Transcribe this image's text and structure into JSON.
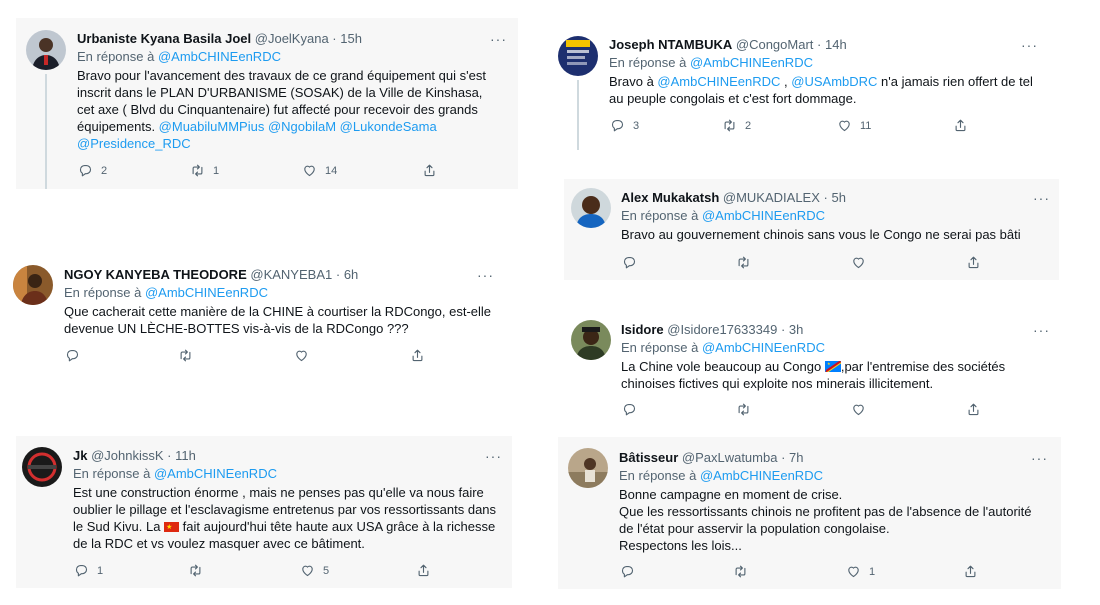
{
  "reply_prefix": "En réponse à",
  "reply_to": "@AmbCHINEenRDC",
  "more": "···",
  "sep": "·",
  "colors": {
    "link": "#1d9bf0",
    "muted": "#536471",
    "card_bg": "#f7f7f7"
  },
  "tweets": [
    {
      "name": "Urbaniste Kyana Basila Joel",
      "handle": "@JoelKyana",
      "time": "15h",
      "text_1": "Bravo pour l'avancement des travaux de ce grand équipement qui s'est inscrit dans le PLAN D'URBANISME (SOSAK) de la Ville de Kinshasa, cet axe ( Blvd du Cinquantenaire) fut affecté pour recevoir des grands équipements. ",
      "mentions": "@MuabiluMMPius @NgobilaM @LukondeSama @Presidence_RDC",
      "replies": "2",
      "retweets": "1",
      "likes": "14"
    },
    {
      "name": "NGOY KANYEBA THEODORE",
      "handle": "@KANYEBA1",
      "time": "6h",
      "text": "Que cacherait cette manière de la CHINE à courtiser la RDCongo, est-elle devenue UN LÈCHE-BOTTES vis-à-vis de la RDCongo ???",
      "replies": "",
      "retweets": "",
      "likes": ""
    },
    {
      "name": "Jk",
      "handle": "@JohnkissK",
      "time": "11h",
      "text_1": "Est une construction énorme , mais ne penses pas qu'elle va nous faire oublier le pillage et l'esclavagisme entretenus par vos ressortissants dans le Sud Kivu. La ",
      "text_2": " fait aujourd'hui tête haute  aux USA grâce à la richesse de la RDC et vs voulez masquer avec ce bâtiment.",
      "replies": "1",
      "retweets": "",
      "likes": "5"
    },
    {
      "name": "Joseph NTAMBUKA",
      "handle": "@CongoMart",
      "time": "14h",
      "text_1": "Bravo à ",
      "mention_1": "@AmbCHINEenRDC",
      "text_2": " , ",
      "mention_2": "@USAmbDRC",
      "text_3": " n'a jamais rien offert de tel au peuple congolais et c'est fort dommage.",
      "replies": "3",
      "retweets": "2",
      "likes": "11"
    },
    {
      "name": "Alex Mukakatsh",
      "handle": "@MUKADIALEX",
      "time": "5h",
      "text": "Bravo au gouvernement chinois sans vous le Congo ne serai pas bâti",
      "replies": "",
      "retweets": "",
      "likes": ""
    },
    {
      "name": "Isidore",
      "handle": "@Isidore17633349",
      "time": "3h",
      "text_1": "La Chine vole beaucoup au Congo ",
      "text_2": ",par l'entremise des sociétés chinoises fictives qui exploite nos minerais illicitement.",
      "replies": "",
      "retweets": "",
      "likes": ""
    },
    {
      "name": "Bâtisseur",
      "handle": "@PaxLwatumba",
      "time": "7h",
      "line_1": "Bonne campagne en moment de crise.",
      "line_2": "Que les ressortissants chinois ne profitent pas de l'absence de l'autorité de l'état pour asservir la population congolaise.",
      "line_3": "Respectons les lois...",
      "replies": "",
      "retweets": "",
      "likes": "1"
    }
  ]
}
